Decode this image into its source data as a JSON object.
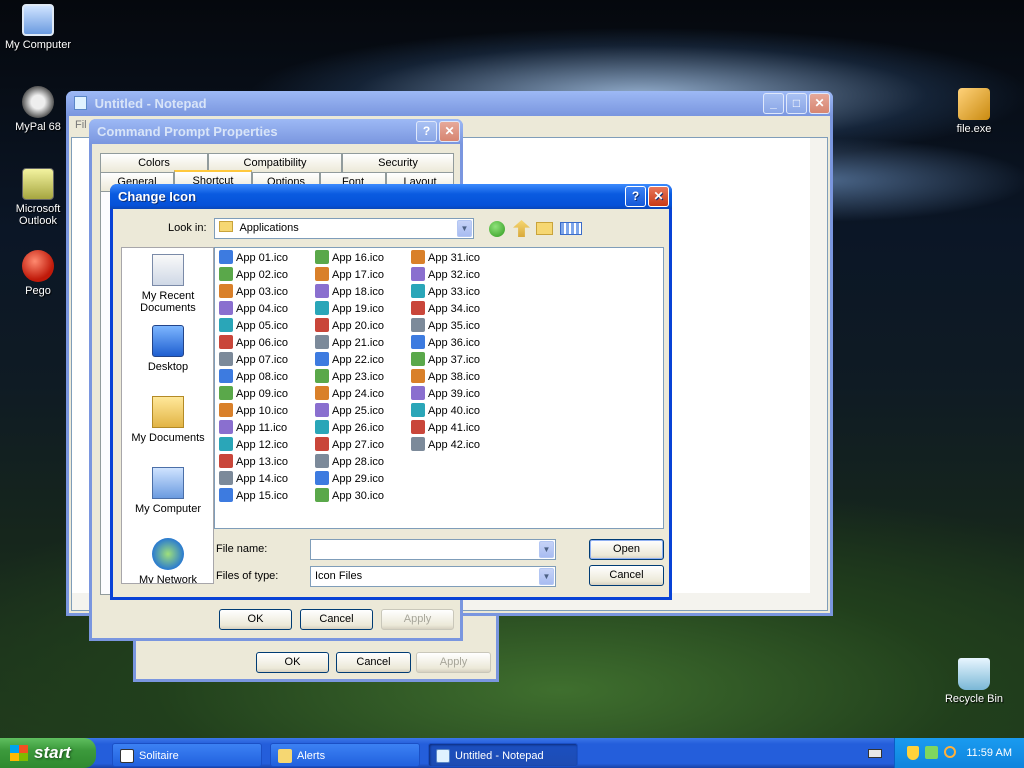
{
  "desktop": {
    "icons": [
      {
        "label": "My Computer"
      },
      {
        "label": "MyPal 68"
      },
      {
        "label": "Microsoft Outlook"
      },
      {
        "label": "Pego"
      },
      {
        "label": "file.exe"
      },
      {
        "label": "Recycle Bin"
      }
    ]
  },
  "notepad": {
    "title": "Untitled - Notepad",
    "menu_fragment": "Fil"
  },
  "cmd_props": {
    "title": "Command Prompt Properties",
    "tabs": [
      "Colors",
      "Compatibility",
      "Security",
      "General",
      "Shortcut",
      "Options",
      "Font",
      "Layout"
    ],
    "ok": "OK",
    "cancel": "Cancel",
    "apply": "Apply"
  },
  "back_dialog": {
    "ok": "OK",
    "cancel": "Cancel",
    "apply": "Apply"
  },
  "change_icon": {
    "title": "Change Icon",
    "look_in_label": "Look in:",
    "look_in_value": "Applications",
    "places": [
      "My Recent Documents",
      "Desktop",
      "My Documents",
      "My Computer",
      "My Network"
    ],
    "file_name_label": "File name:",
    "file_name_value": "",
    "files_of_type_label": "Files of type:",
    "files_of_type_value": "Icon Files",
    "open": "Open",
    "cancel": "Cancel",
    "files": [
      "App 01.ico",
      "App 02.ico",
      "App 03.ico",
      "App 04.ico",
      "App 05.ico",
      "App 06.ico",
      "App 07.ico",
      "App 08.ico",
      "App 09.ico",
      "App 10.ico",
      "App 11.ico",
      "App 12.ico",
      "App 13.ico",
      "App 14.ico",
      "App 15.ico",
      "App 16.ico",
      "App 17.ico",
      "App 18.ico",
      "App 19.ico",
      "App 20.ico",
      "App 21.ico",
      "App 22.ico",
      "App 23.ico",
      "App 24.ico",
      "App 25.ico",
      "App 26.ico",
      "App 27.ico",
      "App 28.ico",
      "App 29.ico",
      "App 30.ico",
      "App 31.ico",
      "App 32.ico",
      "App 33.ico",
      "App 34.ico",
      "App 35.ico",
      "App 36.ico",
      "App 37.ico",
      "App 38.ico",
      "App 39.ico",
      "App 40.ico",
      "App 41.ico",
      "App 42.ico"
    ]
  },
  "taskbar": {
    "start": "start",
    "tasks": [
      "Solitaire",
      "Alerts",
      "Untitled - Notepad"
    ],
    "clock": "11:59 AM"
  },
  "colors": {
    "xp_blue": "#0842d6",
    "taskbar": "#245edb",
    "start_green": "#3c9a3c",
    "dialog_bg": "#ece9d8"
  }
}
